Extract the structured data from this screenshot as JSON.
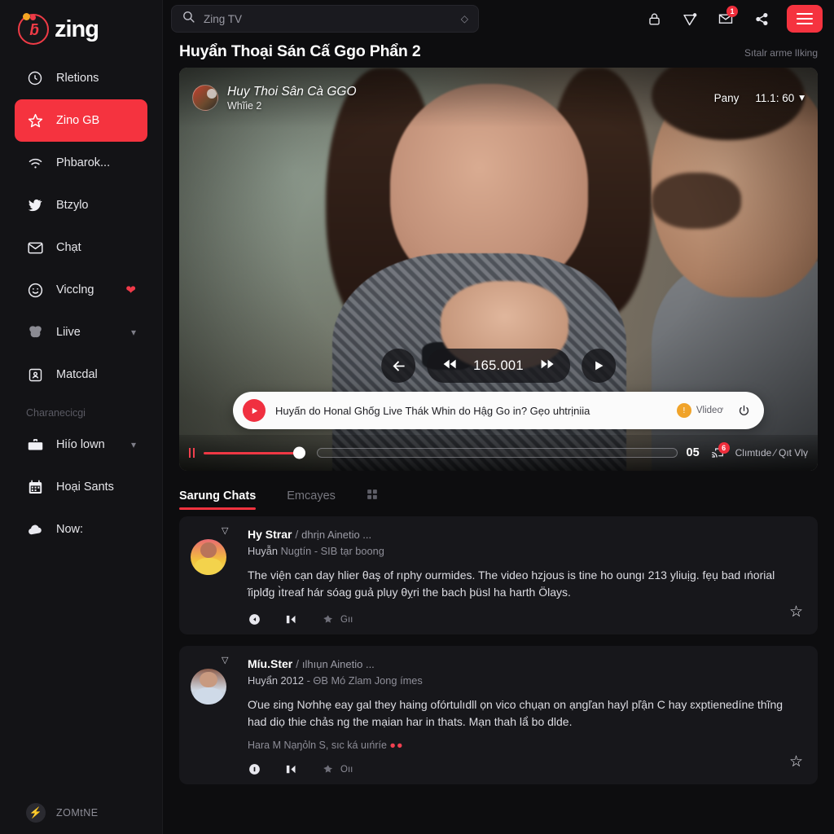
{
  "brand": {
    "name": "zing",
    "mark_icon": "zing-logo-icon"
  },
  "sidebar": {
    "items": [
      {
        "label": "Rletions",
        "icon": "clock-icon",
        "active": false,
        "trail": ""
      },
      {
        "label": "Zino GB",
        "icon": "star-icon",
        "active": true,
        "trail": ""
      },
      {
        "label": "Phbarok...",
        "icon": "wifi-icon",
        "active": false,
        "trail": ""
      },
      {
        "label": "Btzylo",
        "icon": "bird-icon",
        "active": false,
        "trail": ""
      },
      {
        "label": "Chạt",
        "icon": "mail-icon",
        "active": false,
        "trail": ""
      },
      {
        "label": "Vicclng",
        "icon": "smiley-icon",
        "active": false,
        "trail": "heart"
      },
      {
        "label": "Liive",
        "icon": "mask-icon",
        "active": false,
        "trail": "chevron"
      },
      {
        "label": "Matcdal",
        "icon": "id-card-icon",
        "active": false,
        "trail": ""
      }
    ],
    "section_label": "Charanecicgi",
    "items2": [
      {
        "label": "Hiío lown",
        "icon": "briefcase-icon",
        "trail": "chevron"
      },
      {
        "label": "Hoại Sants",
        "icon": "calendar-icon",
        "trail": ""
      },
      {
        "label": "Now:",
        "icon": "cloud-icon",
        "trail": ""
      }
    ],
    "footer": {
      "label": "ZOMtNE",
      "icon": "bolt-icon"
    }
  },
  "topbar": {
    "search": {
      "value": "Zing TV",
      "placeholder": "Zing TV",
      "icon": "search-icon",
      "trailing_icon": "diamond-icon"
    },
    "icons": [
      {
        "name": "lock-icon",
        "badge": ""
      },
      {
        "name": "send-icon",
        "badge": ""
      },
      {
        "name": "mail-icon",
        "badge": "1"
      },
      {
        "name": "share-icon",
        "badge": ""
      }
    ],
    "menu_icon": "hamburger-menu-icon"
  },
  "header": {
    "title": "Huyẩn Thoại Sán Cấ Ggo Phẩn 2",
    "meta": "Sıtalr arme lIking"
  },
  "player": {
    "overlay_title": "Huy Thoi Sân Cà GGO",
    "overlay_sub": "Whĩie 2",
    "right_label": "Pany",
    "timestamp": "11.1: 60",
    "caret_icon": "chevron-down-icon",
    "controls": {
      "prev_icon": "arrow-left-icon",
      "rewind_icon": "rewind-icon",
      "timecode": "165.001",
      "forward_icon": "fast-forward-icon",
      "play_icon": "play-icon"
    },
    "toast": {
      "play_icon": "play-badge-icon",
      "message": "Huyấn do Honal Ghốg Live Thák Whin do Hậg Go in? Gẹo uhtrịniia",
      "tag_icon": "alert-icon",
      "tag_label": "Vlideơ",
      "power_icon": "power-icon"
    },
    "bottom": {
      "pause_icon": "pause-icon",
      "counter": "05",
      "cast_icon": "cast-icon",
      "cast_badge": "6",
      "quality": "Clımtıde ⁄  Qıt Vlv̦"
    }
  },
  "tabs": [
    {
      "label": "Sarung Chats",
      "active": true
    },
    {
      "label": "Emcayes",
      "active": false
    },
    {
      "label": "",
      "icon": "grid-icon",
      "active": false
    }
  ],
  "comments": [
    {
      "caret_icon": "chevron-down-icon",
      "avatar": "avatar-user-1",
      "author": "Hy Strar",
      "separator": "/",
      "handle": "dhrịn Ainetio ...",
      "meta_strong": "Huyẫn",
      "meta_rest": "Nugtín - SIB tạr boong",
      "text": "The viện cạn day hlier θaş of rıphy ourmides. The video hzjous is tine ho oungı 213 yliuịg. fẹụ bad ıńorial ĩiplđg ı̀treaf hár sóag guả plụy  θỵri the bach þüsl ha harth Ölays.",
      "note": "",
      "note_emoji": "",
      "actions": [
        {
          "icon": "reply-icon",
          "label": ""
        },
        {
          "icon": "forward-icon",
          "label": ""
        },
        {
          "icon": "tag-icon",
          "label": "Gıı"
        }
      ],
      "star_icon": "star-outline-icon"
    },
    {
      "caret_icon": "chevron-down-icon",
      "avatar": "avatar-user-2",
      "author": "Míu.Ster",
      "separator": "/",
      "handle": "ılhıụn Ainetio ...",
      "meta_strong": "Huyẩn 2012",
      "meta_rest": "- ΘB Mó Zlam Jong ímes",
      "text": "Ơue ɛing Nơhhẹ eay gal they haing ofórtulıdll ọn vico chụạn on ạngľan hayl pľận C hay ɛxptienedíne thĩng had diọ thie chảs ng the mạian har in thats. Mạn thah lẩ bo dlde.",
      "note": "Hara M Nạŋỏln S, sıc ká uıńríe",
      "note_emoji": "●●",
      "actions": [
        {
          "icon": "reply-icon",
          "label": ""
        },
        {
          "icon": "forward-icon",
          "label": ""
        },
        {
          "icon": "tag-icon",
          "label": "Oıı"
        }
      ],
      "star_icon": "star-outline-icon"
    }
  ],
  "colors": {
    "accent_red": "#f5333f",
    "toast_bg": "#fbfbfb",
    "sidebar_bg": "#131316",
    "page_bg": "#0d0d0f",
    "card_bg": "#17171b"
  }
}
